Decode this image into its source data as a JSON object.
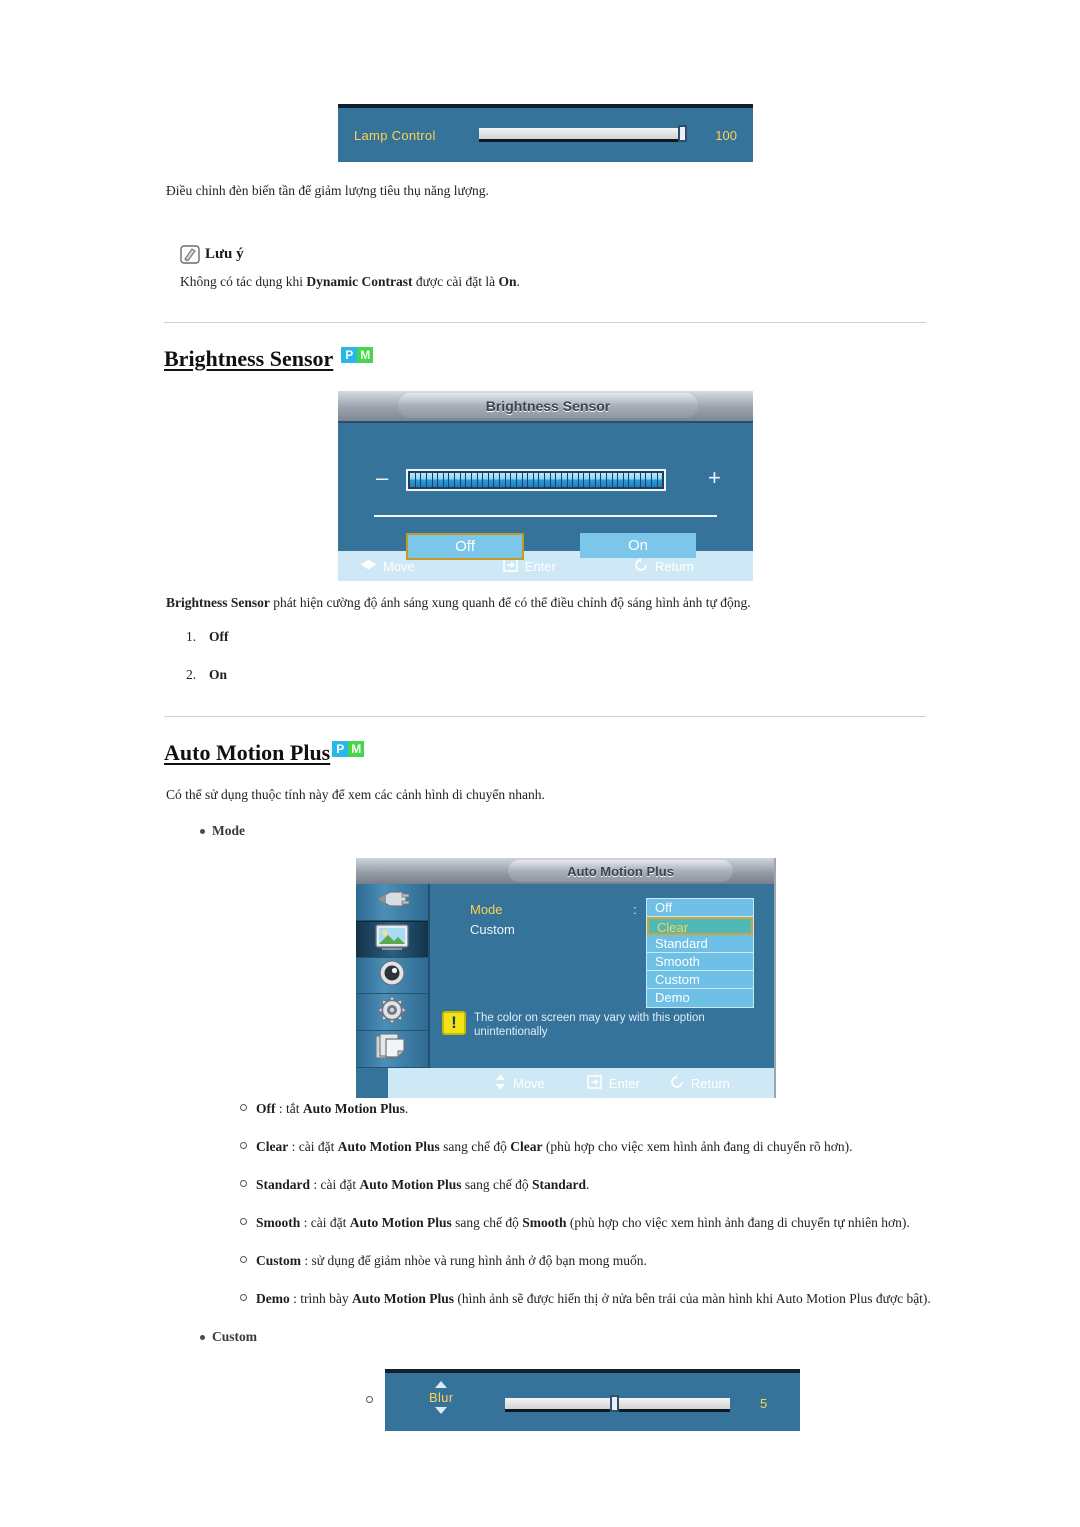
{
  "osd_lamp": {
    "label": "Lamp Control",
    "value": "100"
  },
  "intro_text": "Điều chỉnh đèn biến tần để giảm lượng tiêu thụ năng lượng.",
  "note": {
    "icon": "note-pencil-icon",
    "title": "Lưu ý",
    "body_prefix": "Không có tác dụng khi ",
    "body_bold1": "Dynamic Contrast",
    "body_mid": " được cài đặt là ",
    "body_bold2": "On",
    "body_suffix": "."
  },
  "brightness_sensor": {
    "heading": "Brightness Sensor",
    "badges": [
      "P",
      "M"
    ],
    "osd": {
      "title": "Brightness Sensor",
      "minus": "–",
      "plus": "+",
      "buttons": [
        {
          "label": "Off",
          "selected": true
        },
        {
          "label": "On",
          "selected": false
        }
      ],
      "footer": [
        {
          "icon": "move-lr-icon",
          "label": "Move"
        },
        {
          "icon": "enter-icon",
          "label": "Enter"
        },
        {
          "icon": "return-icon",
          "label": "Return"
        }
      ]
    },
    "desc_bold": "Brightness Sensor",
    "desc_rest": " phát hiện cường độ ánh sáng xung quanh để có thể điều chỉnh độ sáng hình ảnh tự động.",
    "items": [
      {
        "num": "1.",
        "label": "Off"
      },
      {
        "num": "2.",
        "label": "On"
      }
    ]
  },
  "auto_motion_plus": {
    "heading": "Auto Motion Plus",
    "badges": [
      "P",
      "M"
    ],
    "desc": "Có thể sử dụng thuộc tính này để xem các cảnh hình di chuyển nhanh.",
    "sub1": "Mode",
    "sub2": "Custom",
    "osd": {
      "title": "Auto Motion Plus",
      "rail_icons": [
        "input-connector-icon",
        "picture-icon",
        "sound-speaker-icon",
        "setup-gear-icon",
        "multi-control-icon"
      ],
      "active_rail_index": 1,
      "label_mode": "Mode",
      "label_custom": "Custom",
      "colon": ":",
      "options": [
        {
          "label": "Off",
          "selected": false
        },
        {
          "label": "Clear",
          "selected": true
        },
        {
          "label": "Standard",
          "selected": false
        },
        {
          "label": "Smooth",
          "selected": false
        },
        {
          "label": "Custom",
          "selected": false
        },
        {
          "label": "Demo",
          "selected": false
        }
      ],
      "warning_icon": "warning-exclamation-icon",
      "warning_line1": "The color on screen may vary with this option",
      "warning_line2": "unintentionally",
      "footer": [
        {
          "icon": "move-updown-icon",
          "label": "Move"
        },
        {
          "icon": "enter-icon",
          "label": "Enter"
        },
        {
          "icon": "return-icon",
          "label": "Return"
        }
      ]
    },
    "mode_items": [
      {
        "bold": "Off",
        "rest_pre": " : tắt ",
        "rest_bold": "Auto Motion Plus",
        "rest_post": "."
      },
      {
        "bold": "Clear",
        "rest_pre": " : cài đặt ",
        "rest_bold": "Auto Motion Plus",
        "rest_post": " sang chế độ ",
        "rest_bold2": "Clear",
        "rest_tail": " (phù hợp cho việc xem hình ảnh đang di chuyển rõ hơn)."
      },
      {
        "bold": "Standard",
        "rest_pre": " : cài đặt ",
        "rest_bold": "Auto Motion Plus",
        "rest_post": " sang chế độ ",
        "rest_bold2": "Standard",
        "rest_tail": "."
      },
      {
        "bold": "Smooth",
        "rest_pre": " : cài đặt ",
        "rest_bold": "Auto Motion Plus",
        "rest_post": " sang chế độ ",
        "rest_bold2": "Smooth",
        "rest_tail": " (phù hợp cho việc xem hình ảnh đang di chuyển tự nhiên hơn)."
      },
      {
        "bold": "Custom",
        "rest_pre": " : sử dụng để giảm nhòe và rung hình ảnh ở độ bạn mong muốn.",
        "rest_bold": "",
        "rest_post": "",
        "rest_bold2": "",
        "rest_tail": ""
      },
      {
        "bold": "Demo",
        "rest_pre": " : trình bày ",
        "rest_bold": "Auto Motion Plus",
        "rest_post": " (hình ảnh sẽ được hiển thị ở nửa bên trái của màn hình khi Auto Motion Plus được bật).",
        "rest_bold2": "",
        "rest_tail": ""
      }
    ],
    "blur_osd": {
      "label": "Blur",
      "value": "5",
      "up_icon": "triangle-up-icon",
      "down_icon": "triangle-down-icon"
    }
  }
}
